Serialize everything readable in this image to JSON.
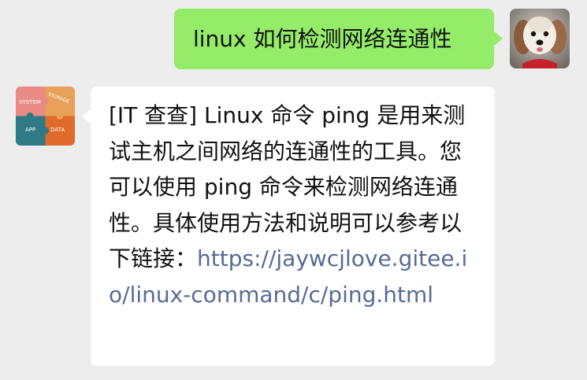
{
  "messages": {
    "outgoing": {
      "text": "linux 如何检测网络连通性"
    },
    "incoming": {
      "text": "[IT 查查] Linux 命令 ping 是用来测试主机之间网络的连通性的工具。您可以使用 ping 命令来检测网络连通性。具体使用方法和说明可以参考以下链接：",
      "link_text": "https://jaywcjlove.gitee.io/linux-command/c/ping.html",
      "avatar": {
        "quadrants": [
          "SYSTEM",
          "STORAGE",
          "APP",
          "DATA"
        ]
      }
    }
  },
  "colors": {
    "background": "#ededed",
    "outgoing_bubble": "#95ec69",
    "incoming_bubble": "#ffffff",
    "link": "#576b95"
  }
}
